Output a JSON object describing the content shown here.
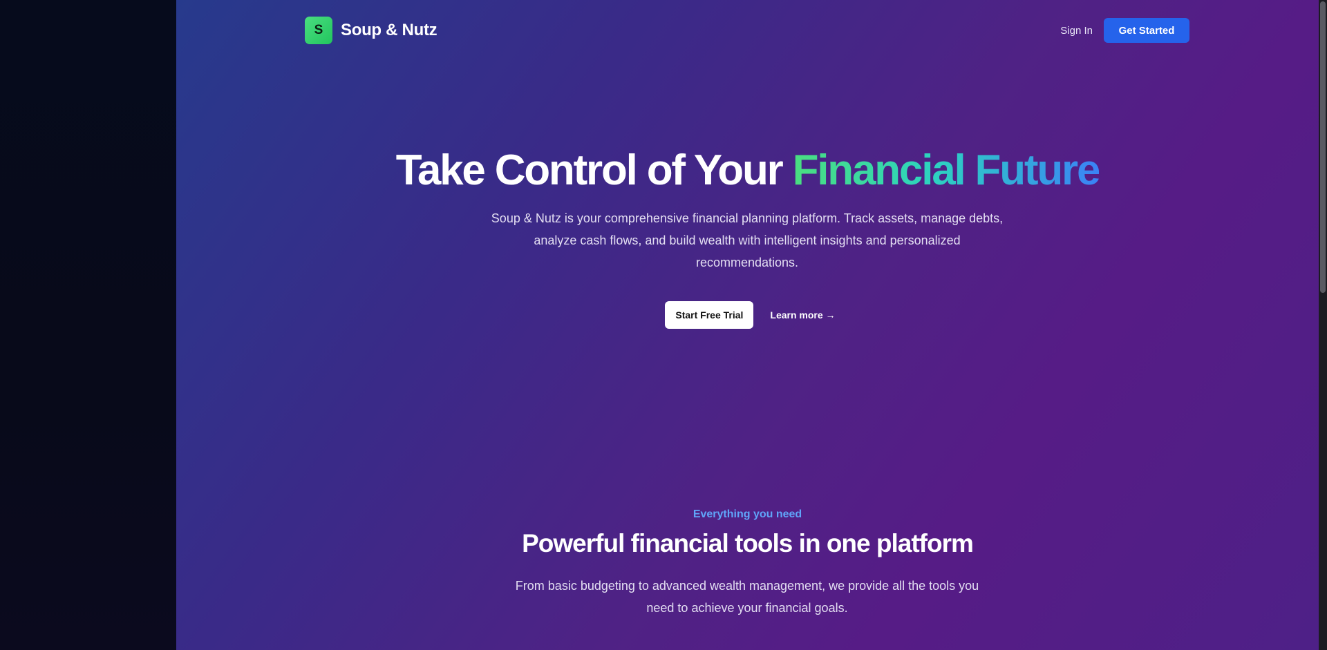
{
  "brand": {
    "logo_letter": "S",
    "name": "Soup & Nutz"
  },
  "nav": {
    "sign_in": "Sign In",
    "get_started": "Get Started"
  },
  "hero": {
    "title_main": "Take Control of Your ",
    "title_accent": "Financial Future",
    "subtitle": "Soup & Nutz is your comprehensive financial planning platform. Track assets, manage debts, analyze cash flows, and build wealth with intelligent insights and personalized recommendations.",
    "cta_primary": "Start Free Trial",
    "cta_secondary": "Learn more →"
  },
  "features": {
    "eyebrow": "Everything you need",
    "title": "Powerful financial tools in one platform",
    "subtitle": "From basic budgeting to advanced wealth management, we provide all the tools you need to achieve your financial goals."
  },
  "colors": {
    "primary_button": "#2563eb",
    "logo_green": "#22c55e",
    "eyebrow_blue": "#60a5fa",
    "accent_gradient_start": "#4ade80",
    "accent_gradient_end": "#3b82f6"
  }
}
